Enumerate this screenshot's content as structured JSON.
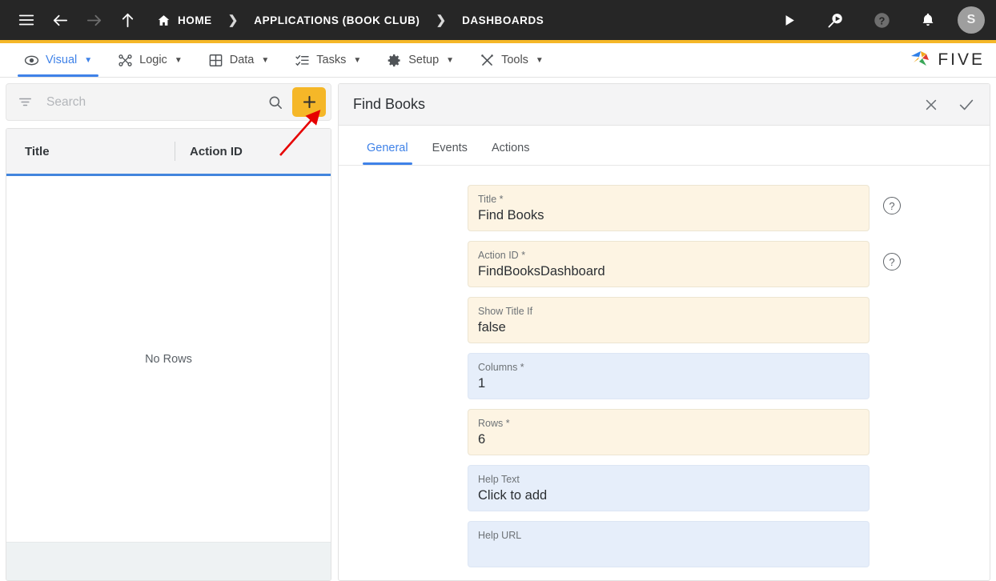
{
  "header": {
    "nav_icons": [
      {
        "name": "hamburger-menu-icon",
        "glyph": "menu"
      },
      {
        "name": "back-arrow-icon",
        "glyph": "arrow-left"
      },
      {
        "name": "forward-arrow-icon",
        "glyph": "arrow-right"
      },
      {
        "name": "up-arrow-icon",
        "glyph": "arrow-up"
      }
    ],
    "breadcrumbs": [
      {
        "label": "HOME",
        "icon": "home-icon"
      },
      {
        "label": "APPLICATIONS (BOOK CLUB)",
        "icon": ""
      },
      {
        "label": "DASHBOARDS",
        "icon": ""
      }
    ],
    "separator": "❯",
    "right_icons": [
      {
        "name": "run-play-icon",
        "glyph": "play"
      },
      {
        "name": "debug-search-icon",
        "glyph": "search-play"
      },
      {
        "name": "help-icon",
        "glyph": "question-circle"
      },
      {
        "name": "notifications-bell-icon",
        "glyph": "bell"
      }
    ],
    "avatar_initial": "S",
    "accent_color": "#f5b728",
    "background_color": "#262626"
  },
  "menubar": {
    "items": [
      {
        "label": "Visual",
        "icon": "eye-icon",
        "active": true,
        "caret": "▼"
      },
      {
        "label": "Logic",
        "icon": "logic-nodes-icon",
        "active": false,
        "caret": "▼"
      },
      {
        "label": "Data",
        "icon": "table-grid-icon",
        "active": false,
        "caret": "▼"
      },
      {
        "label": "Tasks",
        "icon": "checklist-icon",
        "active": false,
        "caret": "▼"
      },
      {
        "label": "Setup",
        "icon": "gear-icon",
        "active": false,
        "caret": "▼"
      },
      {
        "label": "Tools",
        "icon": "wrench-screwdriver-icon",
        "active": false,
        "caret": "▼"
      }
    ],
    "logo_text": "FIVE",
    "active_color": "#3f82e8"
  },
  "sidebar": {
    "search": {
      "placeholder": "Search",
      "value": "",
      "filter_icon": "filter-icon",
      "search_icon": "search-icon"
    },
    "add_button": {
      "label": "+",
      "color": "#f5b728"
    },
    "table": {
      "columns": [
        "Title",
        "Action ID"
      ],
      "rows": [],
      "empty_message": "No Rows"
    }
  },
  "panel": {
    "title": "Find Books",
    "close_label": "✕",
    "confirm_label": "✓",
    "tabs": [
      {
        "label": "General",
        "active": true
      },
      {
        "label": "Events",
        "active": false
      },
      {
        "label": "Actions",
        "active": false
      }
    ],
    "fields": [
      {
        "label": "Title",
        "required": true,
        "value": "Find Books",
        "tone": "cream",
        "help": true
      },
      {
        "label": "Action ID",
        "required": true,
        "value": "FindBooksDashboard",
        "tone": "cream",
        "help": true
      },
      {
        "label": "Show Title If",
        "required": false,
        "value": "false",
        "tone": "cream",
        "help": false
      },
      {
        "label": "Columns",
        "required": true,
        "value": "1",
        "tone": "blue",
        "help": false
      },
      {
        "label": "Rows",
        "required": true,
        "value": "6",
        "tone": "cream",
        "help": false
      },
      {
        "label": "Help Text",
        "required": false,
        "value": "Click to add",
        "tone": "blue",
        "help": false
      },
      {
        "label": "Help URL",
        "required": false,
        "value": "",
        "tone": "blue",
        "help": false
      }
    ]
  },
  "annotation": {
    "arrow_color": "#e60000",
    "points_to": "add-button"
  }
}
